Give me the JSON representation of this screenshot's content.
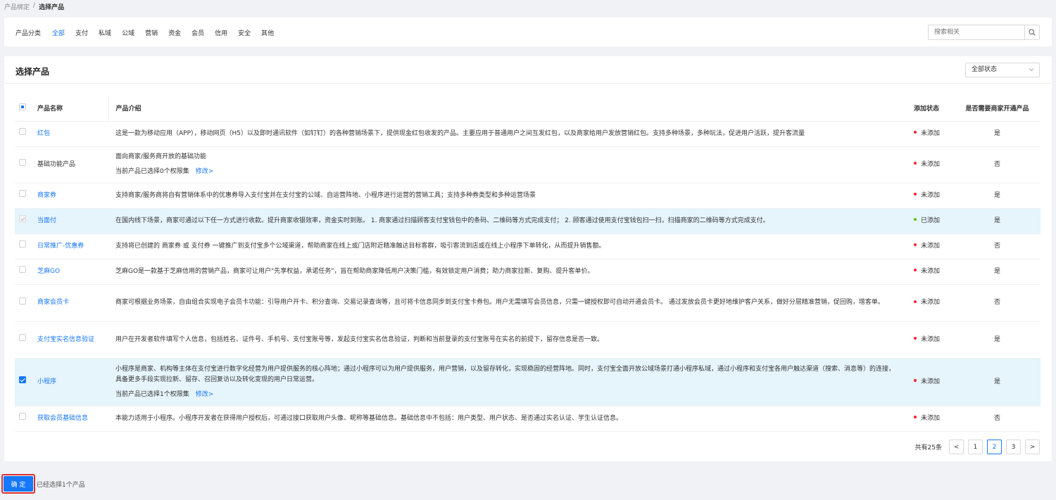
{
  "breadcrumb": {
    "parent": "产品绑定",
    "separator": "/",
    "current": "选择产品"
  },
  "categories": {
    "label": "产品分类",
    "items": [
      "全部",
      "支付",
      "私域",
      "公域",
      "营销",
      "资金",
      "会员",
      "信用",
      "安全",
      "其他"
    ],
    "active_index": 0
  },
  "search": {
    "placeholder": "搜索相关"
  },
  "main": {
    "title": "选择产品",
    "status_filter": "全部状态"
  },
  "table": {
    "headers": {
      "name": "产品名称",
      "intro": "产品介绍",
      "status": "添加状态",
      "need": "是否需要商家开通产品"
    },
    "rows": [
      {
        "name": "红包",
        "is_link": true,
        "intro": "这是一款为移动应用（APP），移动网页（H5）以及即时通讯软件（如钉钉）的各种营销场景下，提供现金红包收发的产品。主要应用于普通用户之间互发红包，以及商家给用户发放营销红包。支持多种场景，多种玩法，促进用户活跃，提升客流量",
        "status": "未添加",
        "status_color": "#f5222d",
        "need": "是",
        "checkbox": "empty"
      },
      {
        "name": "基础功能产品",
        "is_link": false,
        "intro": "面向商家/服务商开放的基础功能",
        "sub_text": "当前产品已选择0个权限集",
        "sub_link": "修改>",
        "status": "未添加",
        "status_color": "#f5222d",
        "need": "否",
        "checkbox": "empty"
      },
      {
        "name": "商家券",
        "is_link": true,
        "intro": "支持商家/服务商将自有营销体系中的优惠券导入支付宝并在支付宝的公域、自运营阵地、小程序进行运营的营销工具；支持多种券类型和多种运营场景",
        "status": "未添加",
        "status_color": "#f5222d",
        "need": "是",
        "checkbox": "empty"
      },
      {
        "name": "当面付",
        "is_link": true,
        "intro": "在国内线下场景，商家可通过以下任一方式进行收款。提升商家收银效率，资金实时到账。 1. 商家通过扫描顾客支付宝钱包中的条码、二维码等方式完成支付； 2. 顾客通过使用支付宝钱包扫一扫，扫描商家的二维码等方式完成支付。",
        "status": "已添加",
        "status_color": "#52c41a",
        "need": "是",
        "checkbox": "disabled",
        "selected": true
      },
      {
        "name": "日常推广-优惠券",
        "is_link": true,
        "intro": "支持将已创建的 商家券 或 支付券 一键推广到支付宝多个公域渠道，帮助商家在线上或门店附近精准触达目标客群，吸引客流到店或在线上小程序下单转化，从而提升销售额。",
        "status": "未添加",
        "status_color": "#f5222d",
        "need": "否",
        "checkbox": "empty"
      },
      {
        "name": "芝麻GO",
        "is_link": true,
        "intro": "芝麻GO是一款基于芝麻信用的营销产品，商家可让用户\"先享权益，承诺任务\"，旨在帮助商家降低用户决策门槛，有效锁定用户消费；助力商家拉新、复购、提升客单价。",
        "status": "未添加",
        "status_color": "#f5222d",
        "need": "是",
        "checkbox": "empty"
      },
      {
        "name": "商家会员卡",
        "is_link": true,
        "intro": "商家可根据业务场景，自由组合实现电子会员卡功能：引导用户开卡、积分查询、交易记录查询等，且可将卡信息同步到支付宝卡券包。用户无需填写会员信息，只需一键授权即可自动开通会员卡。 通过发放会员卡更好地维护客户关系，做好分层精准营销，促回购，增客单。",
        "status": "未添加",
        "status_color": "#f5222d",
        "need": "否",
        "checkbox": "empty"
      },
      {
        "name": "支付宝实名信息验证",
        "is_link": true,
        "intro": "用户在开发者软件填写个人信息，包括姓名、证件号、手机号、支付宝账号等，发起支付宝实名信息验证，判断和当前登录的支付宝账号在实名的前提下，留存信息是否一致。",
        "status": "未添加",
        "status_color": "#f5222d",
        "need": "是",
        "checkbox": "empty"
      },
      {
        "name": "小程序",
        "is_link": true,
        "intro": "小程序是商家、机构等主体在支付宝进行数字化经营为用户提供服务的核心阵地；通过小程序可以为用户提供服务，用户营销，以及留存转化，实现稳固的经营阵地。同时，支付宝全面开放公域场景打通小程序私域，通过小程序和支付宝各用户触达渠道（搜索、消息等）的连接，具备更多手段实现拉新、留存、召回复访以及转化变现的用户日常运营。",
        "sub_text": "当前产品已选择1个权限集",
        "sub_link": "修改>",
        "status": "未添加",
        "status_color": "#f5222d",
        "need": "是",
        "checkbox": "checked",
        "selected": true
      },
      {
        "name": "获取会员基础信息",
        "is_link": true,
        "intro": "本能力适用于小程序。小程序开发者在获得用户授权后，可通过接口获取用户头像、昵称等基础信息。基础信息中不包括：用户类型、用户状态、是否通过实名认证、学生认证信息。",
        "status": "未添加",
        "status_color": "#f5222d",
        "need": "否",
        "checkbox": "empty"
      }
    ]
  },
  "pagination": {
    "total": "共有25条",
    "prev": "<",
    "pages": [
      "1",
      "2",
      "3"
    ],
    "current": "2",
    "next": ">"
  },
  "footer": {
    "confirm_label": "确 定",
    "selected_note": "已经选择1个产品"
  },
  "colors": {
    "accent": "#1677ff",
    "row_selected": "#e6f4fc",
    "highlight_border": "#e03030"
  }
}
